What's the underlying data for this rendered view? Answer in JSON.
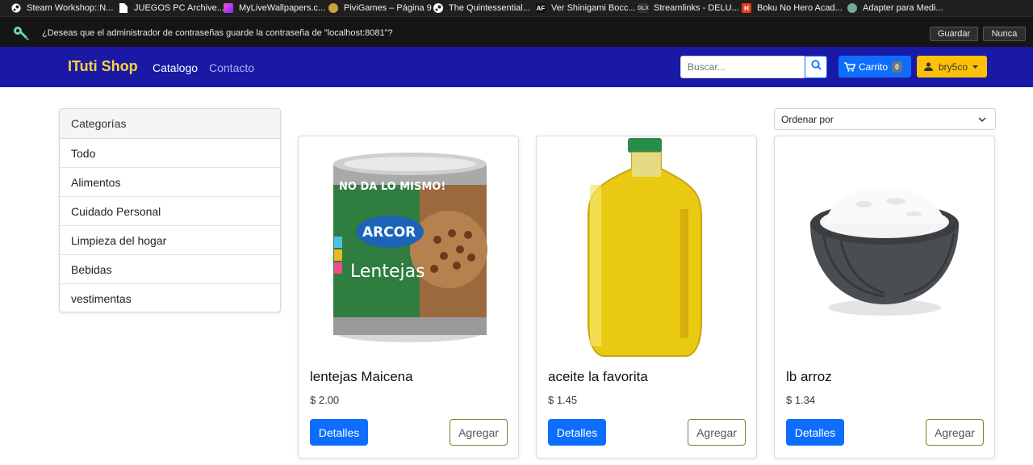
{
  "bookmarks": [
    {
      "label": "Steam Workshop::N...",
      "icon": "steam-icon"
    },
    {
      "label": "JUEGOS PC Archive...",
      "icon": "file-icon"
    },
    {
      "label": "MyLiveWallpapers.c...",
      "icon": "mylivewallpapers-icon"
    },
    {
      "label": "PiviGames – Página 9",
      "icon": "pivigames-icon"
    },
    {
      "label": "The Quintessential...",
      "icon": "steam-icon"
    },
    {
      "label": "Ver Shinigami Bocc...",
      "icon": "af-icon"
    },
    {
      "label": "Streamlinks - DELU...",
      "icon": "dlx-icon"
    },
    {
      "label": "Boku No Hero Acad...",
      "icon": "h-icon"
    },
    {
      "label": "Adapter para Medi...",
      "icon": "chatgpt-icon"
    }
  ],
  "password_prompt": {
    "message": "¿Deseas que el administrador de contraseñas guarde la contraseña de \"localhost:8081\"?",
    "save_label": "Guardar",
    "never_label": "Nunca"
  },
  "navbar": {
    "brand": "ITuti Shop",
    "links": [
      "Catalogo",
      "Contacto"
    ],
    "search_placeholder": "Buscar...",
    "cart_label": "Carrito",
    "cart_count": "0",
    "user_label": "bry5co"
  },
  "categories": {
    "title": "Categorías",
    "items": [
      "Todo",
      "Alimentos",
      "Cuidado Personal",
      "Limpieza del hogar",
      "Bebidas",
      "vestimentas"
    ]
  },
  "sort": {
    "label": "Ordenar por"
  },
  "products": [
    {
      "name": "lentejas Maicena",
      "price": "$ 2.00",
      "details_label": "Detalles",
      "add_label": "Agregar",
      "image": "lentils-can"
    },
    {
      "name": "aceite la favorita",
      "price": "$ 1.45",
      "details_label": "Detalles",
      "add_label": "Agregar",
      "image": "oil-bottle"
    },
    {
      "name": "lb arroz",
      "price": "$ 1.34",
      "details_label": "Detalles",
      "add_label": "Agregar",
      "image": "rice-bowl"
    }
  ],
  "can_label": {
    "promo": "NO DA LO MISMO!",
    "brand": "ARCOR",
    "product": "Lentejas"
  },
  "colors": {
    "navbar": "#1919a6",
    "brand": "#ffd43b",
    "primary": "#0d6efd",
    "warning": "#ffc107"
  }
}
